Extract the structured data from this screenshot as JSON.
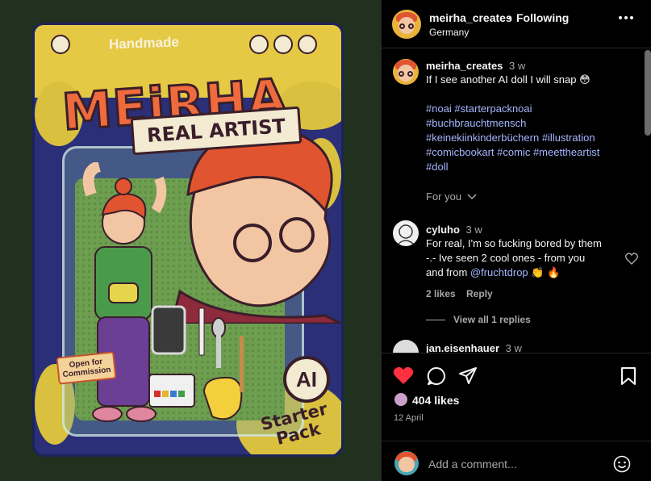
{
  "post_image": {
    "handmade_text": "Handmade",
    "title_text": "MEiRHA",
    "banner_text": "REAL ARTIST",
    "commission_text": "Open for Commission",
    "starter_text_1": "Starter",
    "starter_text_2": "Pack",
    "badge_text": "AI"
  },
  "header": {
    "username": "meirha_creates",
    "dot": "•",
    "follow_status": "Following",
    "location": "Germany"
  },
  "caption": {
    "username": "meirha_creates",
    "time": "3 w",
    "text": "If I see another AI doll I will snap",
    "emoji": "😳",
    "hashtags_line1": "#noai #starterpacknoai",
    "hashtags_line2": "#buchbrauchtmensch",
    "hashtags_line3": "#keinekiinkinderbüchern #illustration",
    "hashtags_line4": "#comicbookart #comic #meettheartist",
    "hashtags_line5": "#doll",
    "for_you": "For you"
  },
  "comments": [
    {
      "username": "cyluho",
      "time": "3 w",
      "line1": "For real, I'm so fucking bored by them",
      "line2": "-.- Ive seen 2 cool ones - from you",
      "line3_pre": "and from ",
      "line3_mention": "@fruchtdrop",
      "line3_emoji": "👏 🔥",
      "likes": "2 likes",
      "reply": "Reply",
      "view_replies": "View all 1 replies"
    },
    {
      "username": "jan.eisenhauer",
      "time": "3 w"
    }
  ],
  "actions": {
    "likes": "404 likes",
    "date": "12 April",
    "add_comment_placeholder": "Add a comment..."
  },
  "colors": {
    "like_red": "#ff3040",
    "hashtag_blue": "#a5b6ff",
    "muted": "#a8a8a8"
  }
}
